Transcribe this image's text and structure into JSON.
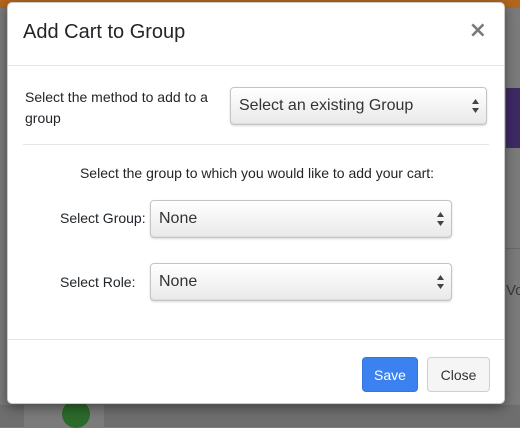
{
  "modal": {
    "title": "Add Cart to Group",
    "close_symbol": "×",
    "method": {
      "label": "Select the method to add to a group",
      "selected": "Select an existing Group"
    },
    "instruction": "Select the group to which you would like to add your cart:",
    "group": {
      "label": "Select Group:",
      "selected": "None"
    },
    "role": {
      "label": "Select Role:",
      "selected": "None"
    },
    "buttons": {
      "save": "Save",
      "close": "Close"
    }
  },
  "background": {
    "partial_text": "Vol"
  },
  "colors": {
    "primary": "#3b82f0",
    "header_strip": "#b5651d",
    "overlay": "#7b7b7b"
  },
  "icons": [
    "close-icon",
    "select-arrows-icon"
  ]
}
